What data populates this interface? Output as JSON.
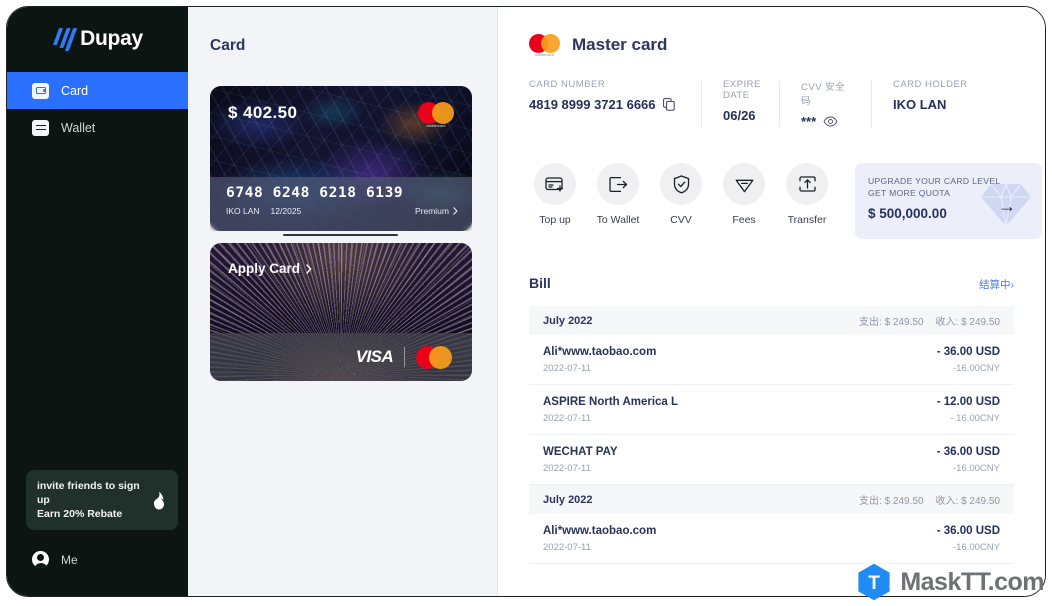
{
  "brand": {
    "name": "Dupay",
    "logo_icon": "slashes-logo"
  },
  "sidebar": {
    "items": [
      {
        "label": "Card",
        "icon": "card-icon",
        "active": true
      },
      {
        "label": "Wallet",
        "icon": "swap-icon",
        "active": false
      }
    ],
    "invite": {
      "line1": "invite friends to sign up",
      "line2": "Earn 20% Rebate",
      "icon": "flame-icon"
    },
    "me": {
      "label": "Me",
      "icon": "user-avatar-icon"
    }
  },
  "cards_panel": {
    "title": "Card",
    "cards": [
      {
        "balance": "$ 402.50",
        "number": "6748 6248 6218 6139",
        "holder": "IKO LAN",
        "expiry": "12/2025",
        "tier": "Premium",
        "brand_icon": "mastercard-logo"
      },
      {
        "apply_label": "Apply Card",
        "brand_icons": [
          "visa-logo",
          "mastercard-logo"
        ]
      }
    ]
  },
  "detail": {
    "title": "Master card",
    "brand_icon": "mastercard-logo",
    "meta": [
      {
        "label": "CARD NUMBER",
        "value": "4819 8999 3721 6666",
        "icon": "copy-icon"
      },
      {
        "label": "EXPIRE DATE",
        "value": "06/26",
        "icon": ""
      },
      {
        "label": "CVV 安全码",
        "value": "***",
        "icon": "eye-icon"
      },
      {
        "label": "CARD HOLDER",
        "value": "IKO LAN",
        "icon": ""
      }
    ],
    "actions": [
      {
        "label": "Top up",
        "icon": "card-plus-icon"
      },
      {
        "label": "To Wallet",
        "icon": "box-arrow-right-icon"
      },
      {
        "label": "CVV",
        "icon": "shield-check-icon"
      },
      {
        "label": "Fees",
        "icon": "diamond-minus-icon"
      },
      {
        "label": "Transfer",
        "icon": "transfer-loop-icon"
      }
    ],
    "upgrade": {
      "line1": "UPGRADE YOUR CARD LEVEL",
      "line2": "GET MORE QUOTA",
      "amount": "$ 500,000.00",
      "icon": "diamond-icon",
      "arrow_icon": "arrow-right-icon"
    },
    "bill": {
      "title": "Bill",
      "link": "结算中›",
      "groups": [
        {
          "month": "July 2022",
          "expense_label": "支出: $ 249.50",
          "income_label": "收入: $ 249.50",
          "transactions": [
            {
              "name": "Ali*www.taobao.com",
              "date": "2022-07-11",
              "usd": "- 36.00 USD",
              "cny": "-16.00CNY"
            },
            {
              "name": "ASPIRE North America L",
              "date": "2022-07-11",
              "usd": "- 12.00 USD",
              "cny": "- 16.00CNY"
            },
            {
              "name": "WECHAT PAY",
              "date": "2022-07-11",
              "usd": "- 36.00 USD",
              "cny": "-16.00CNY"
            }
          ]
        },
        {
          "month": "July 2022",
          "expense_label": "支出: $ 249.50",
          "income_label": "收入: $ 249.50",
          "transactions": [
            {
              "name": "Ali*www.taobao.com",
              "date": "2022-07-11",
              "usd": "- 36.00 USD",
              "cny": "-16.00CNY"
            }
          ]
        }
      ]
    }
  },
  "watermark": {
    "text": "MaskTT.com",
    "badge_letter": "T",
    "badge_color": "#1f8bf5"
  },
  "colors": {
    "sidebar_bg": "#0d1512",
    "accent_blue": "#2b6fff",
    "panel_bg": "#f2f4f7",
    "navy_text": "#2d3561",
    "link_blue": "#3b7df6",
    "upgrade_bg": "#eceffa"
  }
}
